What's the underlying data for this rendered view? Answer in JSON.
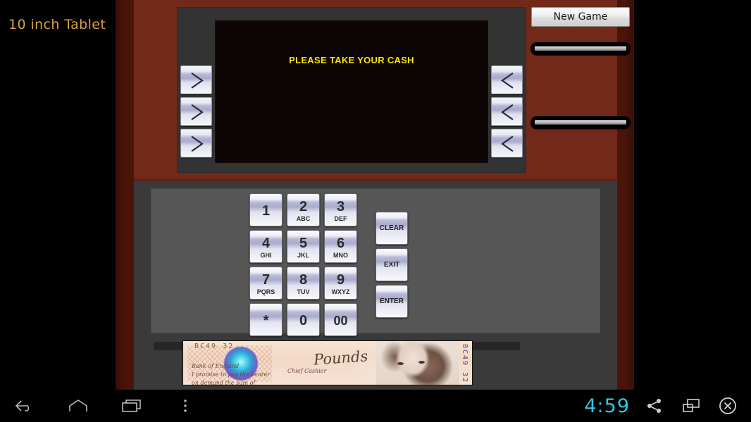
{
  "emulator": {
    "device_label": "10 inch Tablet",
    "label_color": "#d8a33c",
    "background": "#000000"
  },
  "app": {
    "name": "atm-simulator",
    "facia_color_upper": "#72291a",
    "facia_color_lower": "#3a3a3a"
  },
  "atm": {
    "screen": {
      "message": "PLEASE TAKE YOUR CASH",
      "text_color": "#ffe500",
      "background": "#0d0503"
    },
    "softkeys_left": [
      {
        "name": "softkey-left-1",
        "icon": "chevron-right-icon"
      },
      {
        "name": "softkey-left-2",
        "icon": "chevron-right-icon"
      },
      {
        "name": "softkey-left-3",
        "icon": "chevron-right-icon"
      }
    ],
    "softkeys_right": [
      {
        "name": "softkey-right-1",
        "icon": "chevron-left-icon"
      },
      {
        "name": "softkey-right-2",
        "icon": "chevron-left-icon"
      },
      {
        "name": "softkey-right-3",
        "icon": "chevron-left-icon"
      }
    ],
    "side_panel": {
      "new_game_label": "New Game",
      "slots": [
        {
          "name": "card-slot",
          "position": "top"
        },
        {
          "name": "receipt-slot",
          "position": "bottom"
        }
      ]
    },
    "keypad": {
      "rows": [
        [
          {
            "digit": "1",
            "letters": ""
          },
          {
            "digit": "2",
            "letters": "ABC"
          },
          {
            "digit": "3",
            "letters": "DEF"
          }
        ],
        [
          {
            "digit": "4",
            "letters": "GHI"
          },
          {
            "digit": "5",
            "letters": "JKL"
          },
          {
            "digit": "6",
            "letters": "MNO"
          }
        ],
        [
          {
            "digit": "7",
            "letters": "PQRS"
          },
          {
            "digit": "8",
            "letters": "TUV"
          },
          {
            "digit": "9",
            "letters": "WXYZ"
          }
        ],
        [
          {
            "digit": "*",
            "letters": ""
          },
          {
            "digit": "0",
            "letters": ""
          },
          {
            "digit": "00",
            "letters": ""
          }
        ]
      ],
      "function_keys": [
        {
          "label": "CLEAR"
        },
        {
          "label": "EXIT"
        },
        {
          "label": "ENTER"
        }
      ]
    },
    "dispenser": {
      "banknote": {
        "currency_word": "Pounds",
        "serial_left": "BC49 32",
        "serial_right": "BC49 32",
        "promise_line_1": "Bank of England",
        "promise_line_2": "I promise to pay the bearer",
        "promise_line_3": "on demand the sum of",
        "signature": "Chief Cashier"
      }
    }
  },
  "navbar": {
    "buttons": [
      {
        "name": "nav-back-button",
        "icon": "back-arrow-icon"
      },
      {
        "name": "nav-home-button",
        "icon": "home-icon"
      },
      {
        "name": "nav-recents-button",
        "icon": "recents-icon"
      },
      {
        "name": "nav-menu-button",
        "icon": "overflow-menu-icon"
      }
    ],
    "clock": "4:59",
    "right_buttons": [
      {
        "name": "share-button",
        "icon": "share-icon"
      },
      {
        "name": "screenshot-button",
        "icon": "screenshot-icon"
      },
      {
        "name": "close-button",
        "icon": "close-circle-icon"
      }
    ],
    "clock_color": "#30c8e0"
  }
}
